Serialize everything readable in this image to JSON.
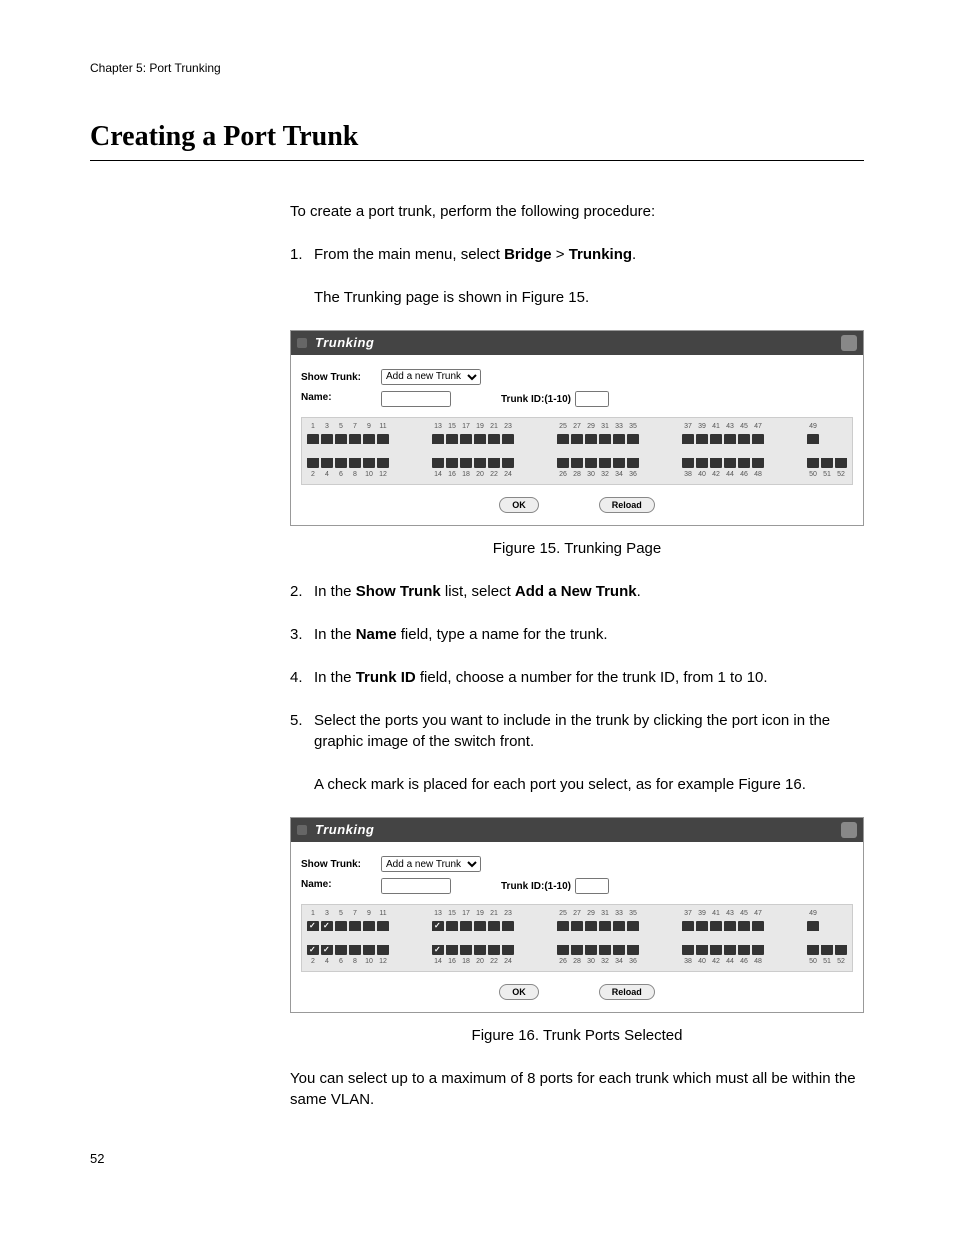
{
  "header": "Chapter 5: Port Trunking",
  "h1": "Creating a Port Trunk",
  "intro": "To create a port trunk, perform the following procedure:",
  "steps": [
    {
      "n": "1.",
      "pre": "From the main menu, select ",
      "b1": "Bridge",
      "mid": " > ",
      "b2": "Trunking",
      "post": ".",
      "tail": "The Trunking page is shown in Figure 15."
    },
    {
      "n": "2.",
      "pre": "In the ",
      "b1": "Show Trunk",
      "mid": " list, select ",
      "b2": "Add a New Trunk",
      "post": "."
    },
    {
      "n": "3.",
      "pre": "In the ",
      "b1": "Name",
      "mid": " field, type a name for the trunk.",
      "b2": "",
      "post": ""
    },
    {
      "n": "4.",
      "pre": "In the ",
      "b1": "Trunk ID",
      "mid": " field, choose a number for the trunk ID, from 1 to 10.",
      "b2": "",
      "post": ""
    },
    {
      "n": "5.",
      "pre": "Select the ports you want to include in the trunk by clicking the port icon in the graphic image of the switch front.",
      "b1": "",
      "mid": "",
      "b2": "",
      "post": "",
      "tail": "A check mark is placed for each port you select, as for example Figure 16."
    }
  ],
  "panel": {
    "title": "Trunking",
    "show_trunk_label": "Show Trunk:",
    "name_label": "Name:",
    "trunk_id_label": "Trunk ID:(1-10)",
    "dropdown": "Add a new Trunk",
    "ok": "OK",
    "reload": "Reload",
    "top_row": [
      1,
      3,
      5,
      7,
      9,
      11,
      13,
      15,
      17,
      19,
      21,
      23,
      25,
      27,
      29,
      31,
      33,
      35,
      37,
      39,
      41,
      43,
      45,
      47,
      49
    ],
    "bottom_row": [
      2,
      4,
      6,
      8,
      10,
      12,
      14,
      16,
      18,
      20,
      22,
      24,
      26,
      28,
      30,
      32,
      34,
      36,
      38,
      40,
      42,
      44,
      46,
      48,
      50,
      51,
      52
    ]
  },
  "fig15_caption": "Figure 15. Trunking Page",
  "fig16_caption": "Figure 16. Trunk Ports Selected",
  "panel2_checked": [
    1,
    2,
    3,
    4,
    13,
    14
  ],
  "closing": "You can select up to a maximum of 8 ports for each trunk which must all be within the same VLAN.",
  "page_number": "52"
}
